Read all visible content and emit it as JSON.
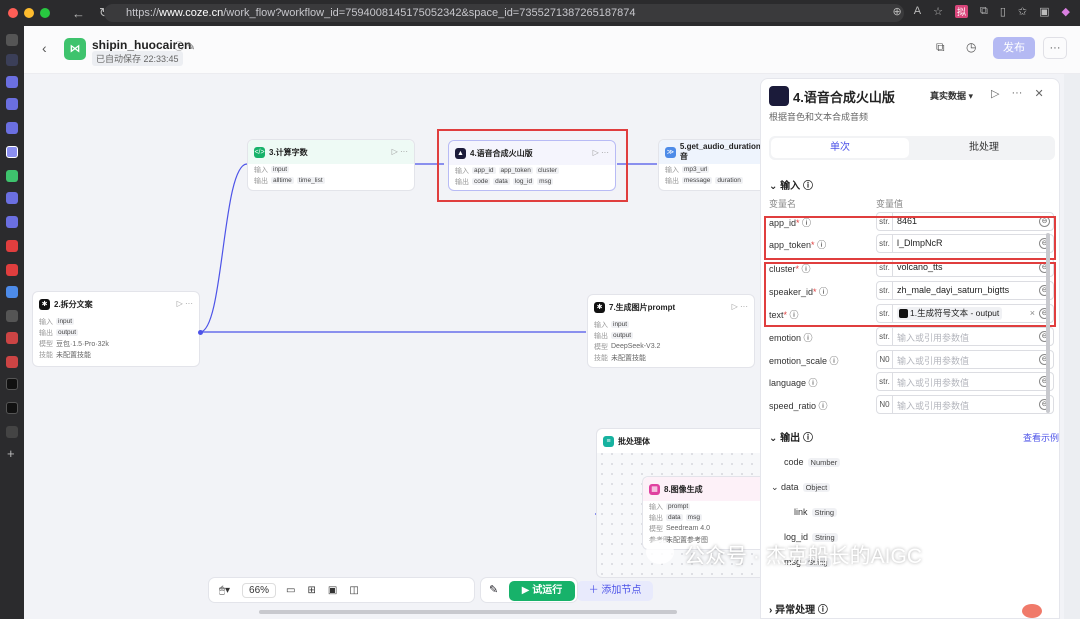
{
  "browser": {
    "url_prefix": "https://",
    "url_domain": "www.coze.cn",
    "url_path": "/work_flow?workflow_id=7594008145175052342&space_id=7355271387265187874",
    "avatar_label": "拟"
  },
  "header": {
    "title": "shipin_huocairen",
    "saved_text": "已自动保存 22:33:45",
    "publish_label": "发布"
  },
  "nodes": {
    "n2": {
      "title": "2.拆分文案",
      "in_label": "输入",
      "out_label": "输出",
      "model_label": "模型",
      "skill_label": "技能",
      "input": "input",
      "output": "output",
      "model": "豆包·1.5·Pro·32k",
      "skill": "未配置技能"
    },
    "n3": {
      "title": "3.计算字数",
      "in_label": "输入",
      "out_label": "输出",
      "input": "input",
      "out1": "alltime",
      "out2": "time_list"
    },
    "n4": {
      "title": "4.语音合成火山版",
      "in_label": "输入",
      "out_label": "输出",
      "in1": "app_id",
      "in2": "app_token",
      "in3": "cluster",
      "out1": "code",
      "out2": "data",
      "out3": "log_id",
      "out4": "msg"
    },
    "n5": {
      "title": "5.get_audio_duration音",
      "in_label": "输入",
      "out_label": "输出",
      "in1": "mp3_url",
      "out1": "message",
      "out2": "duration"
    },
    "n7": {
      "title": "7.生成图片prompt",
      "in_label": "输入",
      "out_label": "输出",
      "model_label": "模型",
      "skill_label": "技能",
      "input": "input",
      "output": "output",
      "model": "DeepSeek-V3.2",
      "skill": "未配置技能"
    },
    "batch": {
      "title": "批处理体"
    },
    "n8": {
      "title": "8.图像生成",
      "in_label": "输入",
      "out_label": "输出",
      "model_label": "模型",
      "ref_label": "参考图",
      "input": "prompt",
      "out1": "data",
      "out2": "msg",
      "model": "Seedream 4.0",
      "ref": "未配置参考图"
    }
  },
  "toolbar": {
    "zoom": "66%",
    "add_node": "添加节点",
    "run": "试运行"
  },
  "watermark": "公众号 · 杰克船长的AIGC",
  "panel": {
    "title": "4.语音合成火山版",
    "subtitle": "根据音色和文本合成音频",
    "real_data": "真实数据 ▾",
    "tabs": [
      "单次",
      "批处理"
    ],
    "input_section": "输入",
    "col_name": "变量名",
    "col_value": "变量值",
    "params": [
      {
        "name": "app_id",
        "required": true,
        "type": "str.",
        "value": "8461",
        "placeholder": ""
      },
      {
        "name": "app_token",
        "required": true,
        "type": "str.",
        "value": "l_DlmpNcR",
        "placeholder": ""
      },
      {
        "name": "cluster",
        "required": true,
        "type": "str.",
        "value": "volcano_tts",
        "placeholder": ""
      },
      {
        "name": "speaker_id",
        "required": true,
        "type": "str.",
        "value": "zh_male_dayi_saturn_bigtts",
        "placeholder": ""
      },
      {
        "name": "text",
        "required": true,
        "type": "str.",
        "value": "1.生成符号文本 - output",
        "placeholder": ""
      },
      {
        "name": "emotion",
        "required": false,
        "type": "str.",
        "value": "",
        "placeholder": "输入或引用参数值"
      },
      {
        "name": "emotion_scale",
        "required": false,
        "type": "N0",
        "value": "",
        "placeholder": "输入或引用参数值"
      },
      {
        "name": "language",
        "required": false,
        "type": "str.",
        "value": "",
        "placeholder": "输入或引用参数值"
      },
      {
        "name": "speed_ratio",
        "required": false,
        "type": "N0",
        "value": "",
        "placeholder": "输入或引用参数值"
      }
    ],
    "output_section": "输出",
    "view_example": "查看示例",
    "outputs": [
      {
        "name": "code",
        "type": "Number"
      },
      {
        "name": "data",
        "type": "Object"
      },
      {
        "name": "link",
        "type": "String"
      },
      {
        "name": "log_id",
        "type": "String"
      },
      {
        "name": "msg",
        "type": "String"
      }
    ],
    "error_section": "异常处理"
  }
}
